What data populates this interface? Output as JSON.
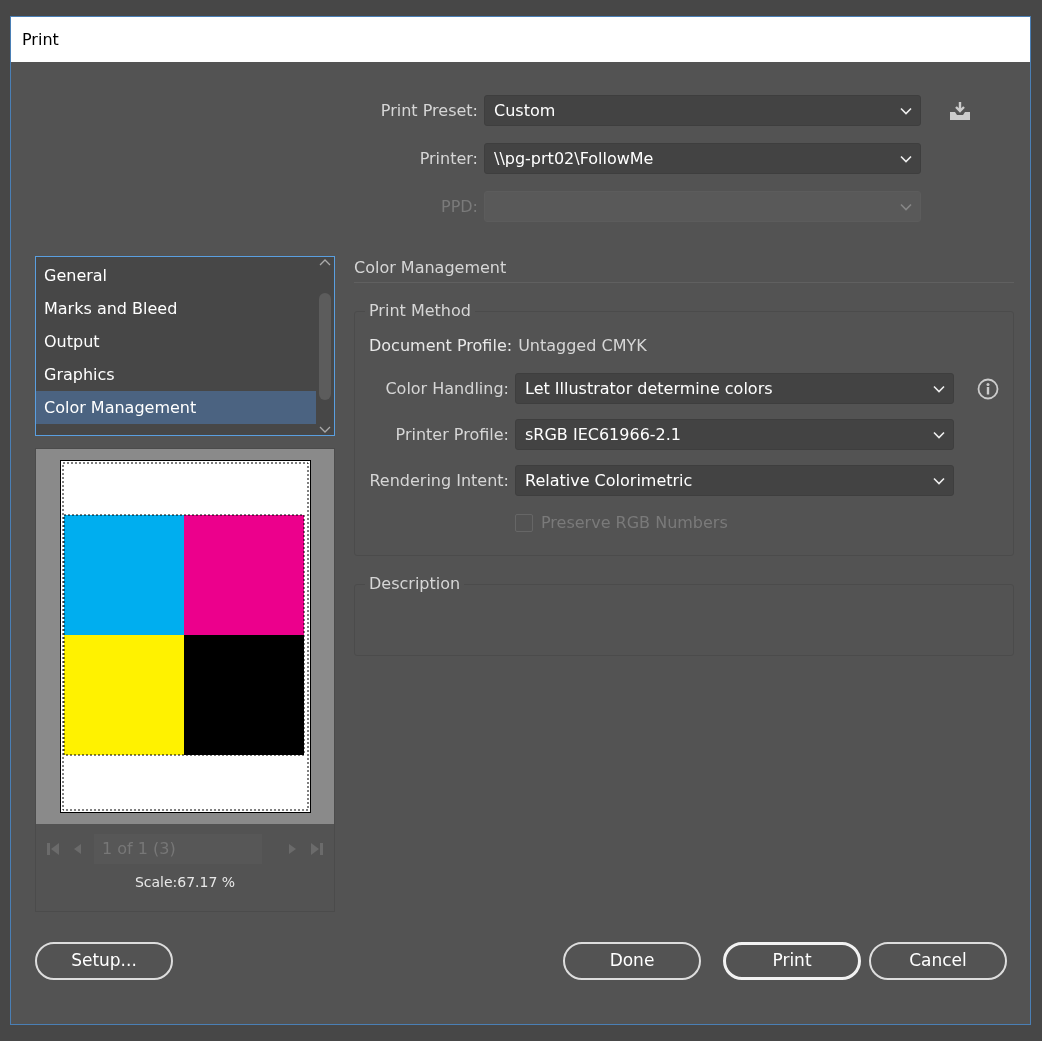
{
  "window": {
    "title": "Print"
  },
  "print_preset": {
    "label": "Print Preset:",
    "value": "Custom"
  },
  "printer": {
    "label": "Printer:",
    "value": "\\\\pg-prt02\\FollowMe"
  },
  "ppd": {
    "label": "PPD:",
    "disabled": true
  },
  "categories": [
    {
      "label": "General",
      "selected": false
    },
    {
      "label": "Marks and Bleed",
      "selected": false
    },
    {
      "label": "Output",
      "selected": false
    },
    {
      "label": "Graphics",
      "selected": false
    },
    {
      "label": "Color Management",
      "selected": true
    }
  ],
  "preview": {
    "page_field": "1 of 1 (3)",
    "navigation_disabled": true,
    "scale": "Scale:67.17 %"
  },
  "section_title": "Color Management",
  "print_method": {
    "legend": "Print Method",
    "document_profile": {
      "label": "Document Profile:",
      "value": "Untagged CMYK"
    },
    "fields": [
      {
        "label": "Color Handling:",
        "value": "Let Illustrator determine colors",
        "info": true
      },
      {
        "label": "Printer Profile:",
        "value": "sRGB IEC61966-2.1",
        "info": false
      },
      {
        "label": "Rendering Intent:",
        "value": "Relative Colorimetric",
        "info": false
      }
    ],
    "preserve_rgb": {
      "label": "Preserve RGB Numbers",
      "checked": false,
      "disabled": true
    }
  },
  "description": {
    "legend": "Description"
  },
  "setup_button": {
    "label": "Setup..."
  },
  "buttons": [
    {
      "label": "Done",
      "default": false
    },
    {
      "label": "Print",
      "default": true
    },
    {
      "label": "Cancel",
      "default": false
    }
  ]
}
